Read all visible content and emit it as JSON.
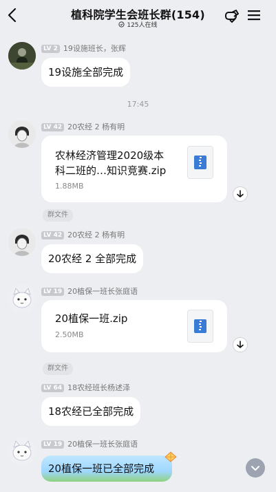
{
  "header": {
    "title": "植科院学生会班长群(154)",
    "online": "125人在线"
  },
  "messages": [
    {
      "level": "LV 2",
      "sender": "19设施班长，张辉",
      "text": "19设施全部完成"
    },
    {
      "level": "LV 42",
      "sender": "20农经 2 杨有明",
      "file_name_line1": "农林经济管理2020级本",
      "file_name_line2": "科二班的…知识竞赛.zip",
      "file_size": "1.88MB"
    },
    {
      "level": "LV 42",
      "sender": "20农经 2 杨有明",
      "text": "20农经 2 全部完成"
    },
    {
      "level": "LV 19",
      "sender": "20植保一班长张庭语",
      "file_name": "20植保一班.zip",
      "file_size": "2.50MB"
    },
    {
      "level": "LV 64",
      "sender": "18农经班长杨述泽",
      "text": "18农经已全部完成"
    },
    {
      "level": "LV 19",
      "sender": "20植保一班长张庭语",
      "text": "20植保一班已全部完成"
    }
  ],
  "timestamp": "17:45",
  "group_file_chip": "群文件",
  "colors": {
    "background": "#edeef2",
    "bubble": "#ffffff",
    "zip_blue": "#3a7bd5"
  }
}
